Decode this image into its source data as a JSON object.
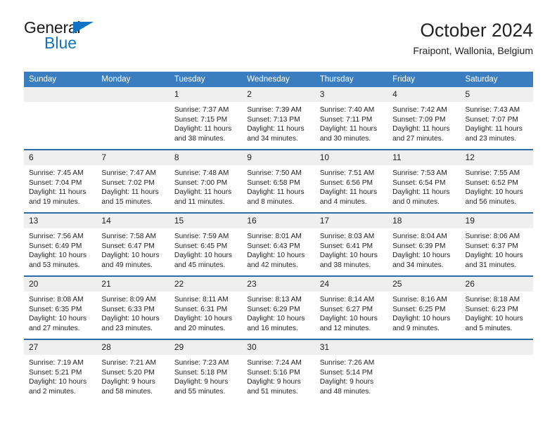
{
  "logo": {
    "word_one": "General",
    "word_two": "Blue",
    "triangle_color": "#1272c4"
  },
  "header": {
    "title": "October 2024",
    "subtitle": "Fraipont, Wallonia, Belgium"
  },
  "theme": {
    "header_blue": "#3a7ebf",
    "row_line_blue": "#2c6ca8",
    "daynum_gray": "#efefef"
  },
  "weekdays": [
    "Sunday",
    "Monday",
    "Tuesday",
    "Wednesday",
    "Thursday",
    "Friday",
    "Saturday"
  ],
  "labels": {
    "sunrise_prefix": "Sunrise:",
    "sunset_prefix": "Sunset:",
    "daylight_prefix": "Daylight:"
  },
  "weeks": [
    [
      {
        "day": "",
        "sunrise": "",
        "sunset": "",
        "daylight": ""
      },
      {
        "day": "",
        "sunrise": "",
        "sunset": "",
        "daylight": ""
      },
      {
        "day": "1",
        "sunrise": "Sunrise: 7:37 AM",
        "sunset": "Sunset: 7:15 PM",
        "daylight": "Daylight: 11 hours and 38 minutes."
      },
      {
        "day": "2",
        "sunrise": "Sunrise: 7:39 AM",
        "sunset": "Sunset: 7:13 PM",
        "daylight": "Daylight: 11 hours and 34 minutes."
      },
      {
        "day": "3",
        "sunrise": "Sunrise: 7:40 AM",
        "sunset": "Sunset: 7:11 PM",
        "daylight": "Daylight: 11 hours and 30 minutes."
      },
      {
        "day": "4",
        "sunrise": "Sunrise: 7:42 AM",
        "sunset": "Sunset: 7:09 PM",
        "daylight": "Daylight: 11 hours and 27 minutes."
      },
      {
        "day": "5",
        "sunrise": "Sunrise: 7:43 AM",
        "sunset": "Sunset: 7:07 PM",
        "daylight": "Daylight: 11 hours and 23 minutes."
      }
    ],
    [
      {
        "day": "6",
        "sunrise": "Sunrise: 7:45 AM",
        "sunset": "Sunset: 7:04 PM",
        "daylight": "Daylight: 11 hours and 19 minutes."
      },
      {
        "day": "7",
        "sunrise": "Sunrise: 7:47 AM",
        "sunset": "Sunset: 7:02 PM",
        "daylight": "Daylight: 11 hours and 15 minutes."
      },
      {
        "day": "8",
        "sunrise": "Sunrise: 7:48 AM",
        "sunset": "Sunset: 7:00 PM",
        "daylight": "Daylight: 11 hours and 11 minutes."
      },
      {
        "day": "9",
        "sunrise": "Sunrise: 7:50 AM",
        "sunset": "Sunset: 6:58 PM",
        "daylight": "Daylight: 11 hours and 8 minutes."
      },
      {
        "day": "10",
        "sunrise": "Sunrise: 7:51 AM",
        "sunset": "Sunset: 6:56 PM",
        "daylight": "Daylight: 11 hours and 4 minutes."
      },
      {
        "day": "11",
        "sunrise": "Sunrise: 7:53 AM",
        "sunset": "Sunset: 6:54 PM",
        "daylight": "Daylight: 11 hours and 0 minutes."
      },
      {
        "day": "12",
        "sunrise": "Sunrise: 7:55 AM",
        "sunset": "Sunset: 6:52 PM",
        "daylight": "Daylight: 10 hours and 56 minutes."
      }
    ],
    [
      {
        "day": "13",
        "sunrise": "Sunrise: 7:56 AM",
        "sunset": "Sunset: 6:49 PM",
        "daylight": "Daylight: 10 hours and 53 minutes."
      },
      {
        "day": "14",
        "sunrise": "Sunrise: 7:58 AM",
        "sunset": "Sunset: 6:47 PM",
        "daylight": "Daylight: 10 hours and 49 minutes."
      },
      {
        "day": "15",
        "sunrise": "Sunrise: 7:59 AM",
        "sunset": "Sunset: 6:45 PM",
        "daylight": "Daylight: 10 hours and 45 minutes."
      },
      {
        "day": "16",
        "sunrise": "Sunrise: 8:01 AM",
        "sunset": "Sunset: 6:43 PM",
        "daylight": "Daylight: 10 hours and 42 minutes."
      },
      {
        "day": "17",
        "sunrise": "Sunrise: 8:03 AM",
        "sunset": "Sunset: 6:41 PM",
        "daylight": "Daylight: 10 hours and 38 minutes."
      },
      {
        "day": "18",
        "sunrise": "Sunrise: 8:04 AM",
        "sunset": "Sunset: 6:39 PM",
        "daylight": "Daylight: 10 hours and 34 minutes."
      },
      {
        "day": "19",
        "sunrise": "Sunrise: 8:06 AM",
        "sunset": "Sunset: 6:37 PM",
        "daylight": "Daylight: 10 hours and 31 minutes."
      }
    ],
    [
      {
        "day": "20",
        "sunrise": "Sunrise: 8:08 AM",
        "sunset": "Sunset: 6:35 PM",
        "daylight": "Daylight: 10 hours and 27 minutes."
      },
      {
        "day": "21",
        "sunrise": "Sunrise: 8:09 AM",
        "sunset": "Sunset: 6:33 PM",
        "daylight": "Daylight: 10 hours and 23 minutes."
      },
      {
        "day": "22",
        "sunrise": "Sunrise: 8:11 AM",
        "sunset": "Sunset: 6:31 PM",
        "daylight": "Daylight: 10 hours and 20 minutes."
      },
      {
        "day": "23",
        "sunrise": "Sunrise: 8:13 AM",
        "sunset": "Sunset: 6:29 PM",
        "daylight": "Daylight: 10 hours and 16 minutes."
      },
      {
        "day": "24",
        "sunrise": "Sunrise: 8:14 AM",
        "sunset": "Sunset: 6:27 PM",
        "daylight": "Daylight: 10 hours and 12 minutes."
      },
      {
        "day": "25",
        "sunrise": "Sunrise: 8:16 AM",
        "sunset": "Sunset: 6:25 PM",
        "daylight": "Daylight: 10 hours and 9 minutes."
      },
      {
        "day": "26",
        "sunrise": "Sunrise: 8:18 AM",
        "sunset": "Sunset: 6:23 PM",
        "daylight": "Daylight: 10 hours and 5 minutes."
      }
    ],
    [
      {
        "day": "27",
        "sunrise": "Sunrise: 7:19 AM",
        "sunset": "Sunset: 5:21 PM",
        "daylight": "Daylight: 10 hours and 2 minutes."
      },
      {
        "day": "28",
        "sunrise": "Sunrise: 7:21 AM",
        "sunset": "Sunset: 5:20 PM",
        "daylight": "Daylight: 9 hours and 58 minutes."
      },
      {
        "day": "29",
        "sunrise": "Sunrise: 7:23 AM",
        "sunset": "Sunset: 5:18 PM",
        "daylight": "Daylight: 9 hours and 55 minutes."
      },
      {
        "day": "30",
        "sunrise": "Sunrise: 7:24 AM",
        "sunset": "Sunset: 5:16 PM",
        "daylight": "Daylight: 9 hours and 51 minutes."
      },
      {
        "day": "31",
        "sunrise": "Sunrise: 7:26 AM",
        "sunset": "Sunset: 5:14 PM",
        "daylight": "Daylight: 9 hours and 48 minutes."
      },
      {
        "day": "",
        "sunrise": "",
        "sunset": "",
        "daylight": ""
      },
      {
        "day": "",
        "sunrise": "",
        "sunset": "",
        "daylight": ""
      }
    ]
  ]
}
